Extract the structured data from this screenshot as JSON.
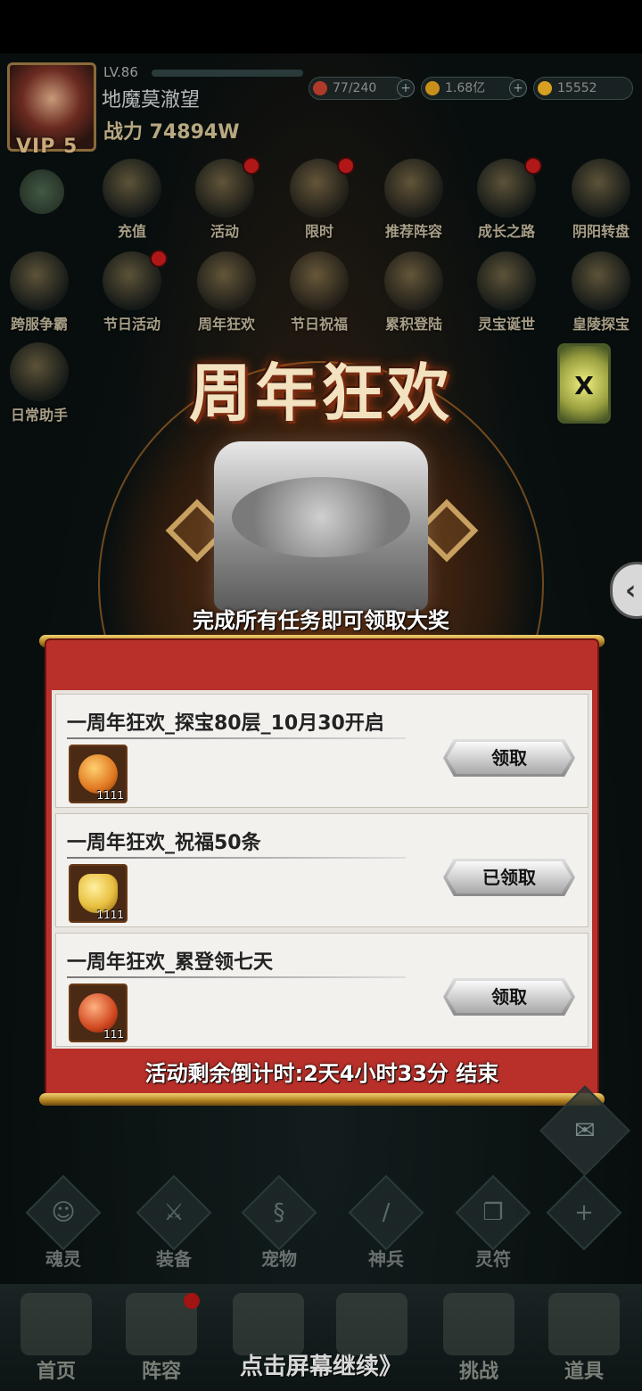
{
  "player": {
    "level": "LV.86",
    "name": "地魔莫澈望",
    "power": "战力 74894W",
    "vip": "VIP 5"
  },
  "resources": [
    {
      "value": "77/240",
      "color": "#b03a2a"
    },
    {
      "value": "1.68亿",
      "color": "#c8901a"
    },
    {
      "value": "15552",
      "color": "#d8a020"
    }
  ],
  "menu_row1": [
    {
      "label": "充值",
      "icon": "gold-ingot-icon",
      "badge": false
    },
    {
      "label": "活动",
      "icon": "events-icon",
      "badge": true
    },
    {
      "label": "限时",
      "icon": "limited-time-icon",
      "badge": true
    },
    {
      "label": "推荐阵容",
      "icon": "lineup-icon",
      "badge": false
    },
    {
      "label": "成长之路",
      "icon": "growth-icon",
      "badge": true
    },
    {
      "label": "阴阳转盘",
      "icon": "wheel-icon",
      "badge": false
    }
  ],
  "menu_row2": [
    {
      "label": "跨服争霸",
      "icon": "cross-server-icon",
      "badge": false
    },
    {
      "label": "节日活动",
      "icon": "festival-icon",
      "badge": true
    },
    {
      "label": "周年狂欢",
      "icon": "anniversary-icon",
      "badge": false
    },
    {
      "label": "节日祝福",
      "icon": "blessing-icon",
      "badge": false
    },
    {
      "label": "累积登陆",
      "icon": "login-icon",
      "badge": false
    },
    {
      "label": "灵宝诞世",
      "icon": "treasure-icon",
      "badge": false
    },
    {
      "label": "皇陵探宝",
      "icon": "tomb-icon",
      "badge": false
    }
  ],
  "menu_row3": [
    {
      "label": "日常助手",
      "icon": "daily-helper-icon",
      "badge": false
    }
  ],
  "event": {
    "title": "周年狂欢",
    "subtitle": "完成所有任务即可领取大奖",
    "countdown": "活动剩余倒计时:2天4小时33分 结束"
  },
  "tasks": [
    {
      "name": "一周年狂欢_探宝80层_10月30开启",
      "count": "1111",
      "button": "领取",
      "gem_color": "#e07820"
    },
    {
      "name": "一周年狂欢_祝福50条",
      "count": "1111",
      "button": "已领取",
      "gem_color": "#e8c040"
    },
    {
      "name": "一周年狂欢_累登领七天",
      "count": "111",
      "button": "领取",
      "gem_color": "#d04820"
    }
  ],
  "quick_menu": [
    {
      "label": "魂灵",
      "icon": "soul-icon"
    },
    {
      "label": "装备",
      "icon": "equipment-icon"
    },
    {
      "label": "宠物",
      "icon": "pet-icon"
    },
    {
      "label": "神兵",
      "icon": "weapon-icon"
    },
    {
      "label": "灵符",
      "icon": "talisman-icon"
    },
    {
      "label": "",
      "icon": "plus-icon"
    }
  ],
  "bottom_nav": [
    {
      "label": "首页",
      "icon": "home-icon",
      "badge": false
    },
    {
      "label": "阵容",
      "icon": "lineup-book-icon",
      "badge": true
    },
    {
      "label": "",
      "icon": "sword-icon",
      "badge": false
    },
    {
      "label": "",
      "icon": "crossed-swords-icon",
      "badge": false
    },
    {
      "label": "挑战",
      "icon": "scroll-icon",
      "badge": false
    },
    {
      "label": "道具",
      "icon": "bag-icon",
      "badge": false
    }
  ],
  "tap_hint": "点击屏幕继续》"
}
